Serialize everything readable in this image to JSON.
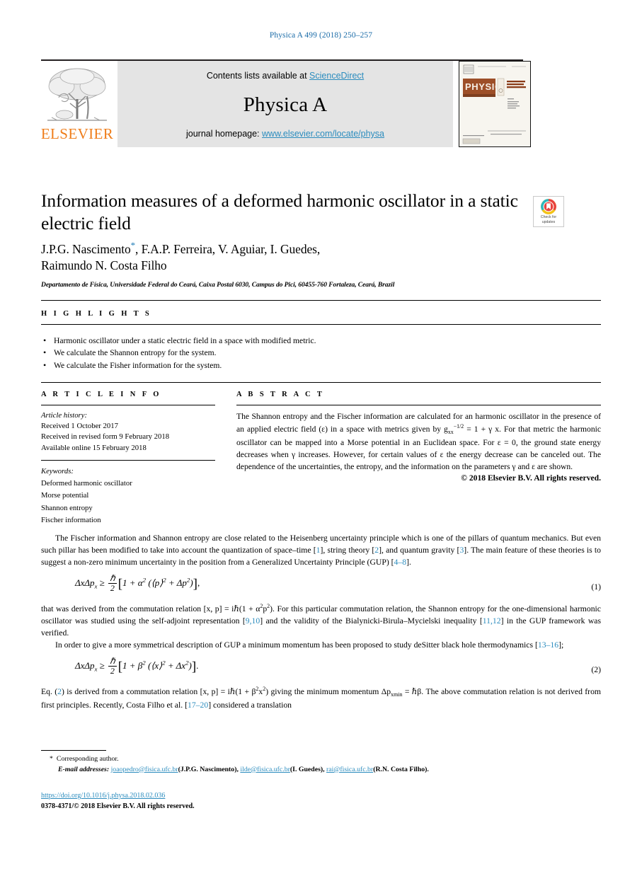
{
  "running_head": "Physica A 499 (2018) 250–257",
  "masthead": {
    "contents_prefix": "Contents lists available at ",
    "sciencedirect": "ScienceDirect",
    "journal_title": "Physica A",
    "homepage_prefix": "journal homepage: ",
    "homepage_url": "www.elsevier.com/locate/physa",
    "publisher": "ELSEVIER",
    "cover_title": "PHYSICA",
    "cover_subtitle": "STATISTICAL MECHANICS AND ITS APPLICATIONS",
    "link_color": "#2b8cbe",
    "band_color": "#e4e4e4",
    "elsevier_orange": "#ef7d1a"
  },
  "title_block": {
    "title": "Information measures of a deformed harmonic oscillator in a static electric field",
    "authors_line1": "J.P.G. Nascimento",
    "authors_star": "*",
    "authors_line1_rest": ", F.A.P. Ferreira, V. Aguiar, I. Guedes,",
    "authors_line2": "Raimundo N. Costa Filho",
    "affiliation": "Departamento de Física, Universidade Federal do Ceará, Caixa Postal 6030, Campus do Pici, 60455-760 Fortaleza, Ceará, Brazil"
  },
  "crossmark": {
    "line1": "Check for",
    "line2": "updates"
  },
  "highlights": {
    "label": "H I G H L I G H T S",
    "items": [
      "Harmonic oscillator under a static electric field in a space with modified metric.",
      "We calculate the Shannon entropy for the system.",
      "We calculate the Fisher information for the system."
    ]
  },
  "article_info": {
    "label": "A R T I C L E    I N F O",
    "history_label": "Article history:",
    "history": [
      "Received 1 October 2017",
      "Received in revised form 9 February 2018",
      "Available online 15 February 2018"
    ],
    "keywords_label": "Keywords:",
    "keywords": [
      "Deformed harmonic oscillator",
      "Morse potential",
      "Shannon entropy",
      "Fischer information"
    ]
  },
  "abstract": {
    "label": "A B S T R A C T",
    "part1": "The Shannon entropy and the Fischer information are calculated for an harmonic oscillator in the presence of an applied electric field (ε) in a space with metrics given by g",
    "gsub": "xx",
    "gsup": "−1/2",
    "part2": " = 1 + γ x. For that metric the harmonic oscillator can be mapped into a Morse potential in an Euclidean space. For ε = 0, the ground state energy decreases when γ increases. However, for certain values of ε the energy decrease can be canceled out. The dependence of the uncertainties, the entropy, and the information on the parameters γ and ε are shown.",
    "copyright": "© 2018 Elsevier B.V. All rights reserved."
  },
  "body": {
    "p1_a": "The Fischer information and Shannon entropy are close related to the Heisenberg uncertainty principle which is one of the pillars of quantum mechanics. But even such pillar has been modified to take into account the quantization of space–time [",
    "p1_r1": "1",
    "p1_b": "], string theory [",
    "p1_r2": "2",
    "p1_c": "], and quantum gravity [",
    "p1_r3": "3",
    "p1_d": "]. The main feature of these theories is to suggest a non-zero minimum uncertainty in the position from a Generalized Uncertainty Principle (GUP) [",
    "p1_r4": "4–8",
    "p1_e": "].",
    "eq1_lhs": "ΔxΔp",
    "eq1_lhs_sub": "x",
    "eq1_rel": " ≥ ",
    "eq1_num": "ℏ",
    "eq1_den": "2",
    "eq1_body_a": "1 + α",
    "eq1_body_sup1": "2",
    "eq1_body_b": " (⟨p⟩",
    "eq1_body_sup2": "2",
    "eq1_body_c": " + Δp",
    "eq1_body_sup3": "2",
    "eq1_body_d": ")",
    "eq1_tail": ",",
    "eq1_number": "(1)",
    "p2_a": "that was derived from the commutation relation [x, p] = iℏ(1 + α",
    "p2_sup1": "2",
    "p2_b": "p",
    "p2_sup2": "2",
    "p2_c": "). For this particular commutation relation, the Shannon entropy for the one-dimensional harmonic oscillator was studied using the self-adjoint representation [",
    "p2_r1": "9,10",
    "p2_d": "] and the validity of the Bialynicki-Birula–Mycielski inequality [",
    "p2_r2": "11,12",
    "p2_e": "] in the GUP framework was verified.",
    "p3_a": "In order to give a more symmetrical description of GUP a minimum momentum has been proposed to study deSitter black hole thermodynamics [",
    "p3_r1": "13–16",
    "p3_b": "];",
    "eq2_lhs": "ΔxΔp",
    "eq2_lhs_sub": "x",
    "eq2_rel": " ≥ ",
    "eq2_num": "ℏ",
    "eq2_den": "2",
    "eq2_body_a": "1 + β",
    "eq2_body_sup1": "2",
    "eq2_body_b": " (⟨x⟩",
    "eq2_body_sup2": "2",
    "eq2_body_c": " + Δx",
    "eq2_body_sup3": "2",
    "eq2_body_d": ")",
    "eq2_tail": ".",
    "eq2_number": "(2)",
    "p4_a": "Eq. (",
    "p4_r0": "2",
    "p4_b": ") is derived from a commutation relation [x, p] = iℏ(1 + β",
    "p4_sup1": "2",
    "p4_c": "x",
    "p4_sup2": "2",
    "p4_d": ") giving the minimum momentum Δp",
    "p4_sub1": "xmin",
    "p4_e": " = ℏβ. The above commutation relation is not derived from first principles. Recently, Costa Filho et al. [",
    "p4_r1": "17–20",
    "p4_f": "] considered a translation"
  },
  "footnotes": {
    "corresponding": "Corresponding author.",
    "star": "*",
    "emails_label": "E-mail addresses:",
    "emails": [
      {
        "address": "joaopedro@fisica.ufc.br",
        "who": "(J.P.G. Nascimento)"
      },
      {
        "address": "ilde@fisica.ufc.br",
        "who": "(I. Guedes)"
      },
      {
        "address": "rai@fisica.ufc.br",
        "who": "(R.N. Costa Filho)"
      }
    ],
    "doi": "https://doi.org/10.1016/j.physa.2018.02.036",
    "issn_line": "0378-4371/© 2018 Elsevier B.V. All rights reserved."
  }
}
